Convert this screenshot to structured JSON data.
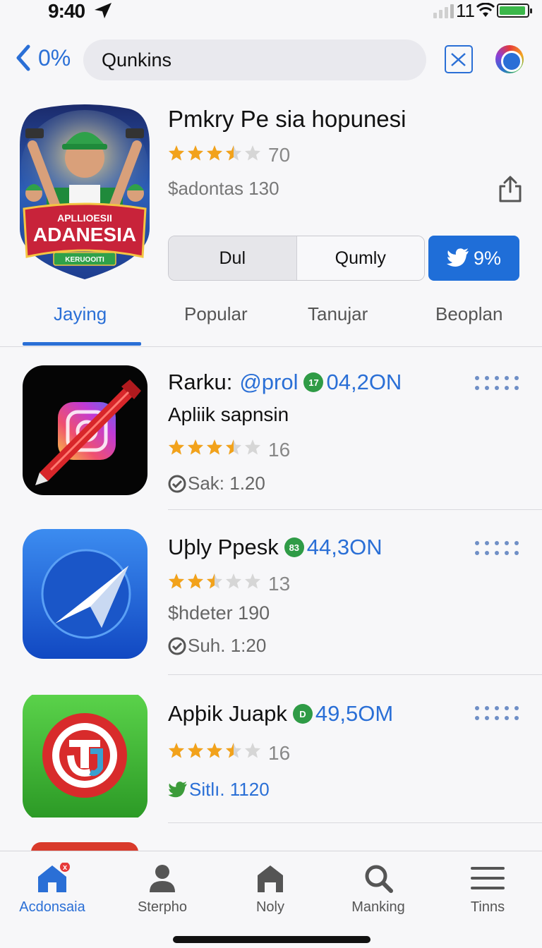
{
  "status_bar": {
    "time": "9:40",
    "network": "11"
  },
  "search": {
    "back_label": "0%",
    "query": "Qunkins"
  },
  "hero": {
    "title": "Pmkry Pe sia hopunesi",
    "rating_count": "70",
    "price_line": "$adontas 130",
    "icon_banner_top": "APLLIOESII",
    "icon_banner_main": "ADANESIA",
    "icon_banner_sub": "KERUOOITI",
    "segment": [
      "Dul",
      "Qumly"
    ],
    "twitter_button": "9%"
  },
  "tabs": [
    "Jaying",
    "Popular",
    "Tanujar",
    "Beoplan"
  ],
  "active_tab": 0,
  "apps": [
    {
      "name": "Rarku:",
      "handle": "@prol",
      "badge": "17",
      "count": "04,2ON",
      "subtitle": "Apliik sapnsin",
      "rating": 3.5,
      "rating_count": "16",
      "price": "",
      "meta": "Sak: 1.20",
      "meta_icon": "check-circle-icon"
    },
    {
      "name": "Uþly Ppesk",
      "handle": "",
      "badge": "83",
      "count": "44,3ON",
      "subtitle": "",
      "rating": 2.5,
      "rating_count": "13",
      "price": "$hdeter 190",
      "meta": "Suh. 1:20",
      "meta_icon": "check-circle-icon"
    },
    {
      "name": "Apþik Juapk",
      "handle": "",
      "badge": "D",
      "count": "49,5OM",
      "subtitle": "",
      "rating": 3.5,
      "rating_count": "16",
      "price": "",
      "meta": "Sitlı. 1120",
      "meta_icon": "twitter-bird-icon"
    }
  ],
  "tab_bar": [
    {
      "label": "Acdonsaia",
      "icon": "home-icon",
      "active": true,
      "badge": "x"
    },
    {
      "label": "Sterpho",
      "icon": "person-icon",
      "active": false
    },
    {
      "label": "Noly",
      "icon": "house-icon",
      "active": false
    },
    {
      "label": "Manking",
      "icon": "search-icon",
      "active": false
    },
    {
      "label": "Tinns",
      "icon": "menu-icon",
      "active": false
    }
  ],
  "colors": {
    "accent": "#2a6fd6",
    "star": "#f2a21b",
    "badge_green": "#2f9b46"
  }
}
